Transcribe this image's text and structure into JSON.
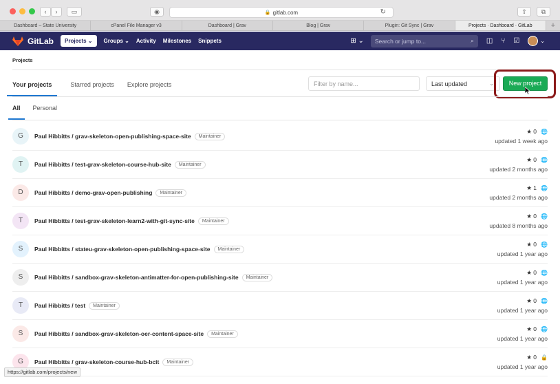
{
  "browser": {
    "url": "gitlab.com",
    "tabs": [
      {
        "label": "Dashboard – State University"
      },
      {
        "label": "cPanel File Manager v3"
      },
      {
        "label": "Dashboard | Grav"
      },
      {
        "label": "Blog | Grav"
      },
      {
        "label": "Plugin: Git Sync | Grav"
      },
      {
        "label": "Projects · Dashboard · GitLab"
      }
    ],
    "status_url": "https://gitlab.com/projects/new"
  },
  "navbar": {
    "brand": "GitLab",
    "items": [
      "Projects ⌄",
      "Groups ⌄",
      "Activity",
      "Milestones",
      "Snippets"
    ],
    "search_placeholder": "Search or jump to...",
    "icons": [
      "plus-square-icon",
      "board-icon",
      "merge-request-icon",
      "check-icon",
      "avatar"
    ]
  },
  "page": {
    "breadcrumb": "Projects",
    "tabs": [
      "Your projects",
      "Starred projects",
      "Explore projects"
    ],
    "filter_placeholder": "Filter by name...",
    "sort_label": "Last updated",
    "new_project_label": "New project",
    "subtabs": [
      "All",
      "Personal"
    ]
  },
  "projects": [
    {
      "initial": "G",
      "avatar_color": "#e8f4f8",
      "name": "Paul Hibbitts / grav-skeleton-open-publishing-space-site",
      "role": "Maintainer",
      "stars": "0",
      "visibility": "public",
      "updated": "updated 1 week ago"
    },
    {
      "initial": "T",
      "avatar_color": "#e0f3f3",
      "name": "Paul Hibbitts / test-grav-skeleton-course-hub-site",
      "role": "Maintainer",
      "stars": "0",
      "visibility": "public",
      "updated": "updated 2 months ago"
    },
    {
      "initial": "D",
      "avatar_color": "#fbe9e7",
      "name": "Paul Hibbitts / demo-grav-open-publishing",
      "role": "Maintainer",
      "stars": "1",
      "visibility": "public",
      "updated": "updated 2 months ago"
    },
    {
      "initial": "T",
      "avatar_color": "#f3e5f5",
      "name": "Paul Hibbitts / test-grav-skeleton-learn2-with-git-sync-site",
      "role": "Maintainer",
      "stars": "0",
      "visibility": "public",
      "updated": "updated 8 months ago"
    },
    {
      "initial": "S",
      "avatar_color": "#e3f2fd",
      "name": "Paul Hibbitts / stateu-grav-skeleton-open-publishing-space-site",
      "role": "Maintainer",
      "stars": "0",
      "visibility": "public",
      "updated": "updated 1 year ago"
    },
    {
      "initial": "S",
      "avatar_color": "#eeeeee",
      "name": "Paul Hibbitts / sandbox-grav-skeleton-antimatter-for-open-publishing-site",
      "role": "Maintainer",
      "stars": "0",
      "visibility": "public",
      "updated": "updated 1 year ago"
    },
    {
      "initial": "T",
      "avatar_color": "#e8eaf6",
      "name": "Paul Hibbitts / test",
      "role": "Maintainer",
      "stars": "0",
      "visibility": "public",
      "updated": "updated 1 year ago"
    },
    {
      "initial": "S",
      "avatar_color": "#fbe9e7",
      "name": "Paul Hibbitts / sandbox-grav-skeleton-oer-content-space-site",
      "role": "Maintainer",
      "stars": "0",
      "visibility": "public",
      "updated": "updated 1 year ago"
    },
    {
      "initial": "G",
      "avatar_color": "#fce4ec",
      "name": "Paul Hibbitts / grav-skeleton-course-hub-bcit",
      "role": "Maintainer",
      "stars": "0",
      "visibility": "private",
      "updated": "updated 1 year ago"
    }
  ]
}
